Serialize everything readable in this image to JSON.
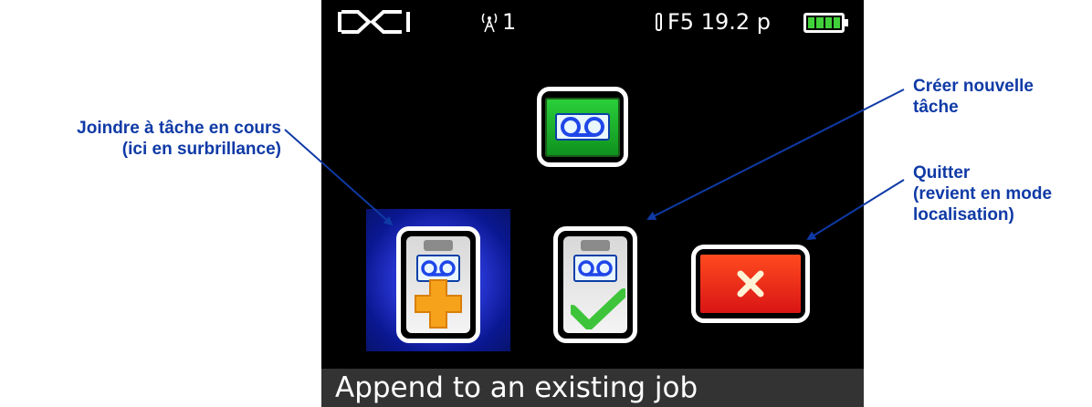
{
  "status_bar": {
    "logo": "DCI",
    "signal_icon": "antenna-signal-icon",
    "signal_channel": "1",
    "frequency": "F5 19.2 p",
    "battery_icon": "battery-full-icon",
    "battery_cells": 4
  },
  "menu": {
    "top_icon": "tape-record-icon",
    "append_icon": "clipboard-tape-plus-icon",
    "create_icon": "clipboard-tape-check-icon",
    "quit_icon": "close-x-icon",
    "selected": "append"
  },
  "status_text": "Append to an existing job",
  "callouts": {
    "append": [
      "Joindre à tâche en cours",
      "(ici en surbrillance)"
    ],
    "create": [
      "Créer nouvelle",
      "tâche"
    ],
    "quit": [
      "Quitter",
      "(revient en mode",
      "localisation)"
    ]
  },
  "colors": {
    "callout_text": "#0f3aa6",
    "highlight": "#2937d6",
    "accent_green": "#2bd13b",
    "quit_red": "#e3181a",
    "plus_orange": "#f7a21b",
    "check_green": "#3ec43a",
    "tape_blue": "#1f47e8"
  }
}
